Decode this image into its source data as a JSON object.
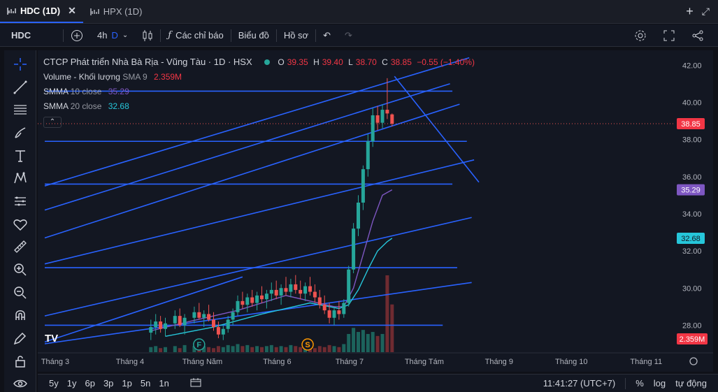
{
  "tabs": [
    {
      "label": "HDC (1D)",
      "active": true
    },
    {
      "label": "HPX (1D)",
      "active": false
    }
  ],
  "toolbar": {
    "symbol": "HDC",
    "interval": "4h",
    "interval_d": "D",
    "indicators_label": "Các chỉ báo",
    "chart_type_label": "Biểu đồ",
    "profile_label": "Hồ sơ"
  },
  "legend": {
    "title": "CTCP Phát triển Nhà Bà Rịa - Vũng Tàu · 1D · HSX",
    "o_label": "O",
    "o": "39.35",
    "h_label": "H",
    "h": "39.40",
    "l_label": "L",
    "l": "38.70",
    "c_label": "C",
    "c": "38.85",
    "change": "−0.55 (−1.40%)",
    "volume_label": "Volume - Khối lượng",
    "volume_sma": "SMA 9",
    "volume_value": "2.359M",
    "smma10_label": "SMMA",
    "smma10_params": "10 close",
    "smma10_value": "35.29",
    "smma20_label": "SMMA",
    "smma20_params": "20 close",
    "smma20_value": "32.68",
    "collapse": "⌃"
  },
  "price_tags": {
    "last": "38.85",
    "smma10": "35.29",
    "smma20": "32.68",
    "volume": "2.359M"
  },
  "colors": {
    "up": "#26a69a",
    "down": "#ef5350",
    "drawing": "#2962ff",
    "smma10": "#7e57c2",
    "smma20": "#26c6da"
  },
  "markers": {
    "f": "F",
    "s": "S"
  },
  "logo": "TV",
  "bottom": {
    "ranges": [
      "5y",
      "1y",
      "6p",
      "3p",
      "1p",
      "5n",
      "1n"
    ],
    "time": "11:41:27 (UTC+7)",
    "percent": "%",
    "log": "log",
    "auto": "tự động"
  },
  "chart_data": {
    "type": "candlestick",
    "title": "CTCP Phát triển Nhà Bà Rịa - Vũng Tàu · 1D · HSX",
    "y_ticks": [
      28.0,
      30.0,
      32.0,
      34.0,
      36.0,
      38.0,
      40.0,
      42.0
    ],
    "y_tick_labels": [
      "28.00",
      "30.00",
      "32.00",
      "34.00",
      "36.00",
      "38.00",
      "40.00",
      "42.00"
    ],
    "ylim": [
      27.0,
      42.8
    ],
    "x_labels": [
      "Tháng 3",
      "Tháng 4",
      "Tháng Năm",
      "Tháng 6",
      "Tháng 7",
      "Tháng Tám",
      "Tháng 9",
      "Tháng 10",
      "Tháng 11"
    ],
    "x_label_days": [
      0,
      31,
      61,
      92,
      122,
      153,
      184,
      214,
      245
    ],
    "candles": [
      {
        "d": 44,
        "o": 27.6,
        "h": 28.3,
        "l": 27.2,
        "c": 27.9
      },
      {
        "d": 46,
        "o": 27.9,
        "h": 28.6,
        "l": 27.5,
        "c": 28.2
      },
      {
        "d": 48,
        "o": 28.2,
        "h": 28.5,
        "l": 27.6,
        "c": 27.8
      },
      {
        "d": 50,
        "o": 27.8,
        "h": 28.4,
        "l": 27.4,
        "c": 28.1
      },
      {
        "d": 54,
        "o": 28.1,
        "h": 28.8,
        "l": 27.8,
        "c": 28.5
      },
      {
        "d": 56,
        "o": 28.5,
        "h": 28.9,
        "l": 27.9,
        "c": 28.0
      },
      {
        "d": 58,
        "o": 28.0,
        "h": 28.6,
        "l": 27.5,
        "c": 28.4
      },
      {
        "d": 62,
        "o": 28.4,
        "h": 29.0,
        "l": 28.1,
        "c": 28.7
      },
      {
        "d": 64,
        "o": 28.7,
        "h": 29.2,
        "l": 28.3,
        "c": 28.4
      },
      {
        "d": 66,
        "o": 28.4,
        "h": 28.8,
        "l": 27.9,
        "c": 28.6
      },
      {
        "d": 68,
        "o": 28.6,
        "h": 29.1,
        "l": 28.2,
        "c": 28.3
      },
      {
        "d": 70,
        "o": 28.3,
        "h": 28.7,
        "l": 27.7,
        "c": 27.9
      },
      {
        "d": 72,
        "o": 27.9,
        "h": 28.2,
        "l": 27.3,
        "c": 27.5
      },
      {
        "d": 74,
        "o": 27.5,
        "h": 28.0,
        "l": 27.2,
        "c": 27.8
      },
      {
        "d": 76,
        "o": 27.8,
        "h": 28.5,
        "l": 27.6,
        "c": 28.3
      },
      {
        "d": 78,
        "o": 28.3,
        "h": 28.9,
        "l": 28.0,
        "c": 28.7
      },
      {
        "d": 80,
        "o": 28.7,
        "h": 29.6,
        "l": 28.5,
        "c": 29.3
      },
      {
        "d": 82,
        "o": 29.3,
        "h": 29.8,
        "l": 28.9,
        "c": 29.1
      },
      {
        "d": 84,
        "o": 29.1,
        "h": 29.7,
        "l": 28.7,
        "c": 29.5
      },
      {
        "d": 86,
        "o": 29.5,
        "h": 29.9,
        "l": 29.0,
        "c": 29.2
      },
      {
        "d": 88,
        "o": 29.2,
        "h": 29.8,
        "l": 28.8,
        "c": 29.6
      },
      {
        "d": 90,
        "o": 29.6,
        "h": 30.1,
        "l": 29.2,
        "c": 29.4
      },
      {
        "d": 92,
        "o": 29.4,
        "h": 29.9,
        "l": 28.9,
        "c": 29.7
      },
      {
        "d": 94,
        "o": 29.7,
        "h": 30.3,
        "l": 29.3,
        "c": 29.9
      },
      {
        "d": 96,
        "o": 29.9,
        "h": 30.4,
        "l": 29.4,
        "c": 29.6
      },
      {
        "d": 98,
        "o": 29.6,
        "h": 30.2,
        "l": 29.1,
        "c": 30.0
      },
      {
        "d": 100,
        "o": 30.0,
        "h": 30.6,
        "l": 29.6,
        "c": 29.8
      },
      {
        "d": 102,
        "o": 29.8,
        "h": 30.5,
        "l": 29.5,
        "c": 30.2
      },
      {
        "d": 104,
        "o": 30.2,
        "h": 30.7,
        "l": 29.7,
        "c": 29.9
      },
      {
        "d": 106,
        "o": 29.9,
        "h": 30.4,
        "l": 29.4,
        "c": 29.7
      },
      {
        "d": 108,
        "o": 29.7,
        "h": 30.3,
        "l": 29.3,
        "c": 30.1
      },
      {
        "d": 110,
        "o": 30.1,
        "h": 30.6,
        "l": 29.6,
        "c": 29.8
      },
      {
        "d": 112,
        "o": 29.8,
        "h": 30.2,
        "l": 29.2,
        "c": 29.5
      },
      {
        "d": 114,
        "o": 29.5,
        "h": 29.9,
        "l": 28.9,
        "c": 29.1
      },
      {
        "d": 116,
        "o": 29.1,
        "h": 29.6,
        "l": 28.6,
        "c": 28.8
      },
      {
        "d": 118,
        "o": 28.8,
        "h": 29.2,
        "l": 28.1,
        "c": 28.4
      },
      {
        "d": 120,
        "o": 28.4,
        "h": 29.0,
        "l": 28.0,
        "c": 28.8
      },
      {
        "d": 122,
        "o": 28.8,
        "h": 29.3,
        "l": 28.3,
        "c": 28.6
      },
      {
        "d": 124,
        "o": 28.6,
        "h": 29.4,
        "l": 28.4,
        "c": 29.2
      },
      {
        "d": 126,
        "o": 29.2,
        "h": 31.2,
        "l": 29.0,
        "c": 31.0
      },
      {
        "d": 128,
        "o": 31.0,
        "h": 33.5,
        "l": 30.8,
        "c": 33.2
      },
      {
        "d": 130,
        "o": 33.2,
        "h": 35.0,
        "l": 32.8,
        "c": 34.6
      },
      {
        "d": 132,
        "o": 34.6,
        "h": 36.6,
        "l": 34.2,
        "c": 36.4
      },
      {
        "d": 134,
        "o": 36.4,
        "h": 38.3,
        "l": 36.0,
        "c": 37.9
      },
      {
        "d": 136,
        "o": 37.9,
        "h": 39.7,
        "l": 37.6,
        "c": 39.3
      },
      {
        "d": 138,
        "o": 39.3,
        "h": 39.8,
        "l": 38.5,
        "c": 38.9
      },
      {
        "d": 140,
        "o": 38.9,
        "h": 39.9,
        "l": 38.6,
        "c": 39.6
      },
      {
        "d": 142,
        "o": 39.6,
        "h": 41.3,
        "l": 39.1,
        "c": 39.4
      },
      {
        "d": 144,
        "o": 39.35,
        "h": 39.4,
        "l": 38.7,
        "c": 38.85
      }
    ],
    "volume_max_label": "2.359M",
    "volumes": [
      {
        "d": 44,
        "v": 0.25
      },
      {
        "d": 46,
        "v": 0.3
      },
      {
        "d": 48,
        "v": 0.2
      },
      {
        "d": 50,
        "v": 0.25
      },
      {
        "d": 54,
        "v": 0.3
      },
      {
        "d": 56,
        "v": 0.2
      },
      {
        "d": 58,
        "v": 0.35
      },
      {
        "d": 62,
        "v": 0.3
      },
      {
        "d": 64,
        "v": 0.25
      },
      {
        "d": 66,
        "v": 0.3
      },
      {
        "d": 68,
        "v": 0.25
      },
      {
        "d": 70,
        "v": 0.2
      },
      {
        "d": 72,
        "v": 0.3
      },
      {
        "d": 74,
        "v": 0.25
      },
      {
        "d": 76,
        "v": 0.35
      },
      {
        "d": 78,
        "v": 0.3
      },
      {
        "d": 80,
        "v": 0.4
      },
      {
        "d": 82,
        "v": 0.3
      },
      {
        "d": 84,
        "v": 0.35
      },
      {
        "d": 86,
        "v": 0.25
      },
      {
        "d": 88,
        "v": 0.3
      },
      {
        "d": 90,
        "v": 0.25
      },
      {
        "d": 92,
        "v": 0.3
      },
      {
        "d": 94,
        "v": 0.35
      },
      {
        "d": 96,
        "v": 0.25
      },
      {
        "d": 98,
        "v": 0.3
      },
      {
        "d": 100,
        "v": 0.25
      },
      {
        "d": 102,
        "v": 0.35
      },
      {
        "d": 104,
        "v": 0.3
      },
      {
        "d": 106,
        "v": 0.25
      },
      {
        "d": 108,
        "v": 0.3
      },
      {
        "d": 110,
        "v": 0.25
      },
      {
        "d": 112,
        "v": 0.2
      },
      {
        "d": 114,
        "v": 0.3
      },
      {
        "d": 116,
        "v": 0.25
      },
      {
        "d": 118,
        "v": 0.35
      },
      {
        "d": 120,
        "v": 0.3
      },
      {
        "d": 122,
        "v": 0.25
      },
      {
        "d": 124,
        "v": 0.4
      },
      {
        "d": 126,
        "v": 0.9
      },
      {
        "d": 128,
        "v": 1.2
      },
      {
        "d": 130,
        "v": 1.0
      },
      {
        "d": 132,
        "v": 1.1
      },
      {
        "d": 134,
        "v": 0.9
      },
      {
        "d": 136,
        "v": 1.0
      },
      {
        "d": 138,
        "v": 0.8
      },
      {
        "d": 140,
        "v": 0.9
      },
      {
        "d": 142,
        "v": 3.8
      },
      {
        "d": 144,
        "v": 2.359
      }
    ],
    "smma10": [
      [
        44,
        27.7
      ],
      [
        60,
        28.2
      ],
      [
        80,
        28.8
      ],
      [
        100,
        29.6
      ],
      [
        120,
        29.0
      ],
      [
        124,
        29.0
      ],
      [
        128,
        30.0
      ],
      [
        132,
        31.8
      ],
      [
        136,
        33.6
      ],
      [
        140,
        35.0
      ],
      [
        144,
        35.29
      ]
    ],
    "smma20": [
      [
        50,
        27.4
      ],
      [
        70,
        27.9
      ],
      [
        90,
        28.6
      ],
      [
        110,
        29.2
      ],
      [
        122,
        28.9
      ],
      [
        126,
        29.1
      ],
      [
        130,
        29.9
      ],
      [
        134,
        31.0
      ],
      [
        138,
        32.0
      ],
      [
        142,
        32.5
      ],
      [
        144,
        32.68
      ]
    ],
    "drawings": {
      "horizontal": [
        [
          0,
          165,
          28.0
        ],
        [
          0,
          171,
          31.1
        ],
        [
          0,
          169,
          35.6
        ],
        [
          0,
          175,
          37.9
        ],
        [
          0,
          169,
          40.6
        ]
      ],
      "trend": [
        [
          0,
          27.0,
          177,
          30.3
        ],
        [
          0,
          28.5,
          177,
          33.8
        ],
        [
          0,
          31.3,
          178,
          36.9
        ],
        [
          0,
          32.7,
          172,
          39.9
        ],
        [
          0,
          34.2,
          168,
          41.0
        ],
        [
          0,
          35.5,
          176,
          42.4
        ],
        [
          0,
          27.1,
          82,
          30.6
        ],
        [
          145,
          41.4,
          180,
          35.7
        ]
      ]
    },
    "grid": false,
    "last_price_line": 38.85
  }
}
